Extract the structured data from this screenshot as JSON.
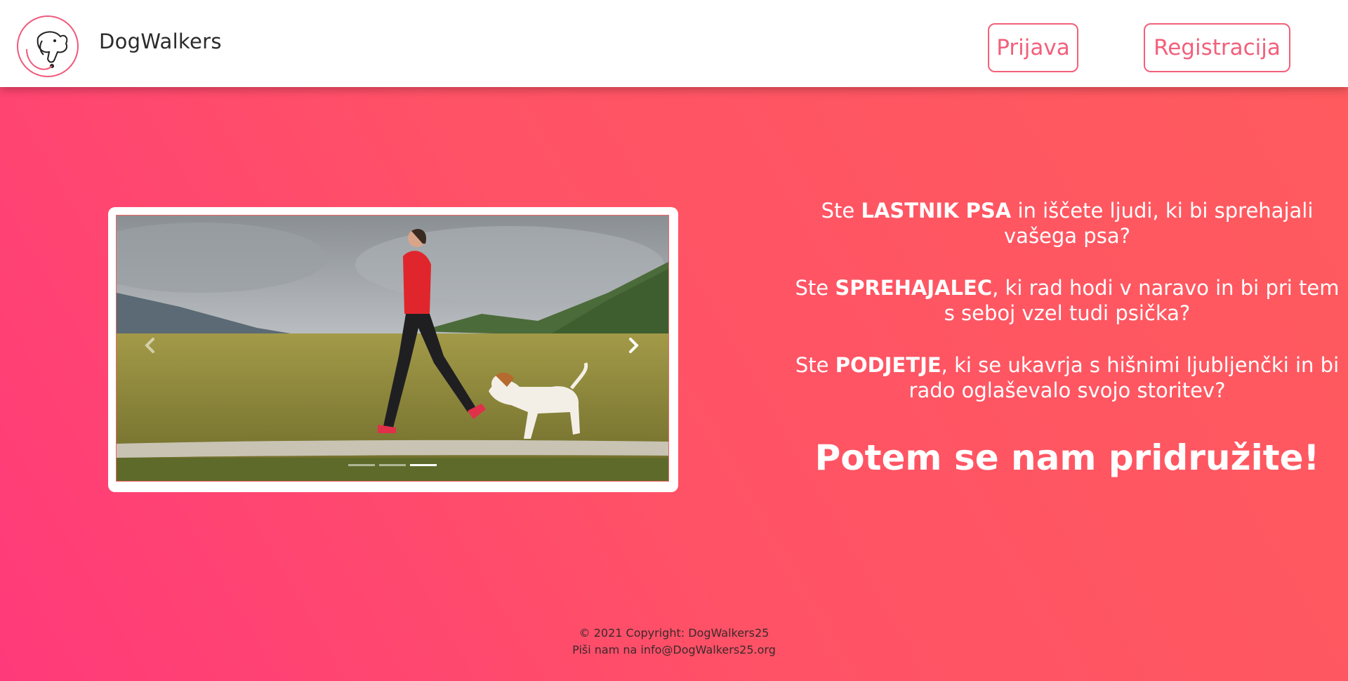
{
  "header": {
    "brand": "DogWalkers",
    "logo_icon": "dog-head-icon",
    "login_label": "Prijava",
    "register_label": "Registracija"
  },
  "carousel": {
    "prev_icon": "chevron-left-icon",
    "next_icon": "chevron-right-icon",
    "slide_count": 3,
    "active_slide": 3
  },
  "intro": {
    "p1": {
      "pre": "Ste ",
      "strong": "LASTNIK PSA",
      "post": " in iščete ljudi, ki bi sprehajali vašega psa?"
    },
    "p2": {
      "pre": "Ste ",
      "strong": "SPREHAJALEC",
      "post": ", ki rad hodi v naravo in bi pri tem s seboj vzel tudi psička?"
    },
    "p3": {
      "pre": "Ste ",
      "strong": "PODJETJE",
      "post": ", ki se ukavrja s hišnimi ljubljenčki in bi rado oglaševalo svojo storitev?"
    },
    "cta": "Potem se nam pridružite!"
  },
  "footer": {
    "copyright": "© 2021 Copyright: DogWalkers25",
    "contact": "Piši nam na info@DogWalkers25.org"
  },
  "colors": {
    "accent": "#f2607b",
    "gradient_start": "#ff3a7a",
    "gradient_end": "#ff5b5e"
  }
}
